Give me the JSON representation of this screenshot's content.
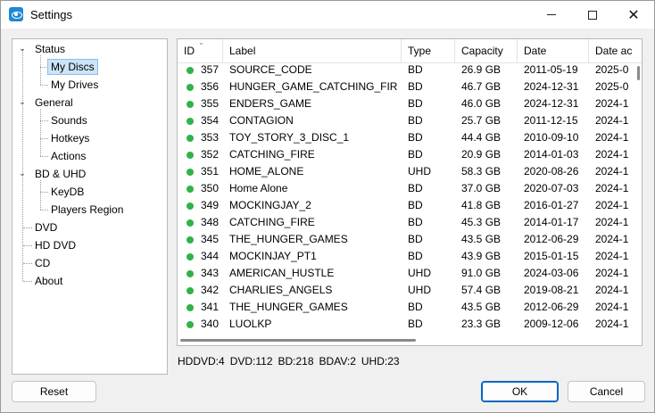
{
  "window": {
    "title": "Settings"
  },
  "colors": {
    "status_green": "#2fb34a",
    "selection": "#cce4f7",
    "accent": "#0067c0"
  },
  "tree": {
    "items": [
      {
        "label": "Status",
        "expander": "minus"
      },
      {
        "label": "My Discs",
        "selected": true
      },
      {
        "label": "My Drives"
      },
      {
        "label": "General",
        "expander": "minus"
      },
      {
        "label": "Sounds"
      },
      {
        "label": "Hotkeys"
      },
      {
        "label": "Actions"
      },
      {
        "label": "BD & UHD",
        "expander": "minus"
      },
      {
        "label": "KeyDB"
      },
      {
        "label": "Players Region"
      },
      {
        "label": "DVD"
      },
      {
        "label": "HD DVD"
      },
      {
        "label": "CD"
      },
      {
        "label": "About"
      }
    ]
  },
  "grid": {
    "columns": [
      "ID",
      "Label",
      "Type",
      "Capacity",
      "Date",
      "Date ac"
    ],
    "rows": [
      {
        "id": "357",
        "label": "SOURCE_CODE",
        "type": "BD",
        "capacity": "26.9 GB",
        "date": "2011-05-19",
        "date_added": "2025-0"
      },
      {
        "id": "356",
        "label": "HUNGER_GAME_CATCHING_FIRE...",
        "type": "BD",
        "capacity": "46.7 GB",
        "date": "2024-12-31",
        "date_added": "2025-0"
      },
      {
        "id": "355",
        "label": "ENDERS_GAME",
        "type": "BD",
        "capacity": "46.0 GB",
        "date": "2024-12-31",
        "date_added": "2024-1"
      },
      {
        "id": "354",
        "label": "CONTAGION",
        "type": "BD",
        "capacity": "25.7 GB",
        "date": "2011-12-15",
        "date_added": "2024-1"
      },
      {
        "id": "353",
        "label": "TOY_STORY_3_DISC_1",
        "type": "BD",
        "capacity": "44.4 GB",
        "date": "2010-09-10",
        "date_added": "2024-1"
      },
      {
        "id": "352",
        "label": "CATCHING_FIRE",
        "type": "BD",
        "capacity": "20.9 GB",
        "date": "2014-01-03",
        "date_added": "2024-1"
      },
      {
        "id": "351",
        "label": "HOME_ALONE",
        "type": "UHD",
        "capacity": "58.3 GB",
        "date": "2020-08-26",
        "date_added": "2024-1"
      },
      {
        "id": "350",
        "label": "Home Alone",
        "type": "BD",
        "capacity": "37.0 GB",
        "date": "2020-07-03",
        "date_added": "2024-1"
      },
      {
        "id": "349",
        "label": "MOCKINGJAY_2",
        "type": "BD",
        "capacity": "41.8 GB",
        "date": "2016-01-27",
        "date_added": "2024-1"
      },
      {
        "id": "348",
        "label": "CATCHING_FIRE",
        "type": "BD",
        "capacity": "45.3 GB",
        "date": "2014-01-17",
        "date_added": "2024-1"
      },
      {
        "id": "345",
        "label": "THE_HUNGER_GAMES",
        "type": "BD",
        "capacity": "43.5 GB",
        "date": "2012-06-29",
        "date_added": "2024-1"
      },
      {
        "id": "344",
        "label": "MOCKINJAY_PT1",
        "type": "BD",
        "capacity": "43.9 GB",
        "date": "2015-01-15",
        "date_added": "2024-1"
      },
      {
        "id": "343",
        "label": "AMERICAN_HUSTLE",
        "type": "UHD",
        "capacity": "91.0 GB",
        "date": "2024-03-06",
        "date_added": "2024-1"
      },
      {
        "id": "342",
        "label": "CHARLIES_ANGELS",
        "type": "UHD",
        "capacity": "57.4 GB",
        "date": "2019-08-21",
        "date_added": "2024-1"
      },
      {
        "id": "341",
        "label": "THE_HUNGER_GAMES",
        "type": "BD",
        "capacity": "43.5 GB",
        "date": "2012-06-29",
        "date_added": "2024-1"
      },
      {
        "id": "340",
        "label": "LUOLKP",
        "type": "BD",
        "capacity": "23.3 GB",
        "date": "2009-12-06",
        "date_added": "2024-1"
      }
    ]
  },
  "stats": [
    "HDDVD:4",
    "DVD:112",
    "BD:218",
    "BDAV:2",
    "UHD:23"
  ],
  "buttons": {
    "reset": "Reset",
    "ok": "OK",
    "cancel": "Cancel"
  }
}
